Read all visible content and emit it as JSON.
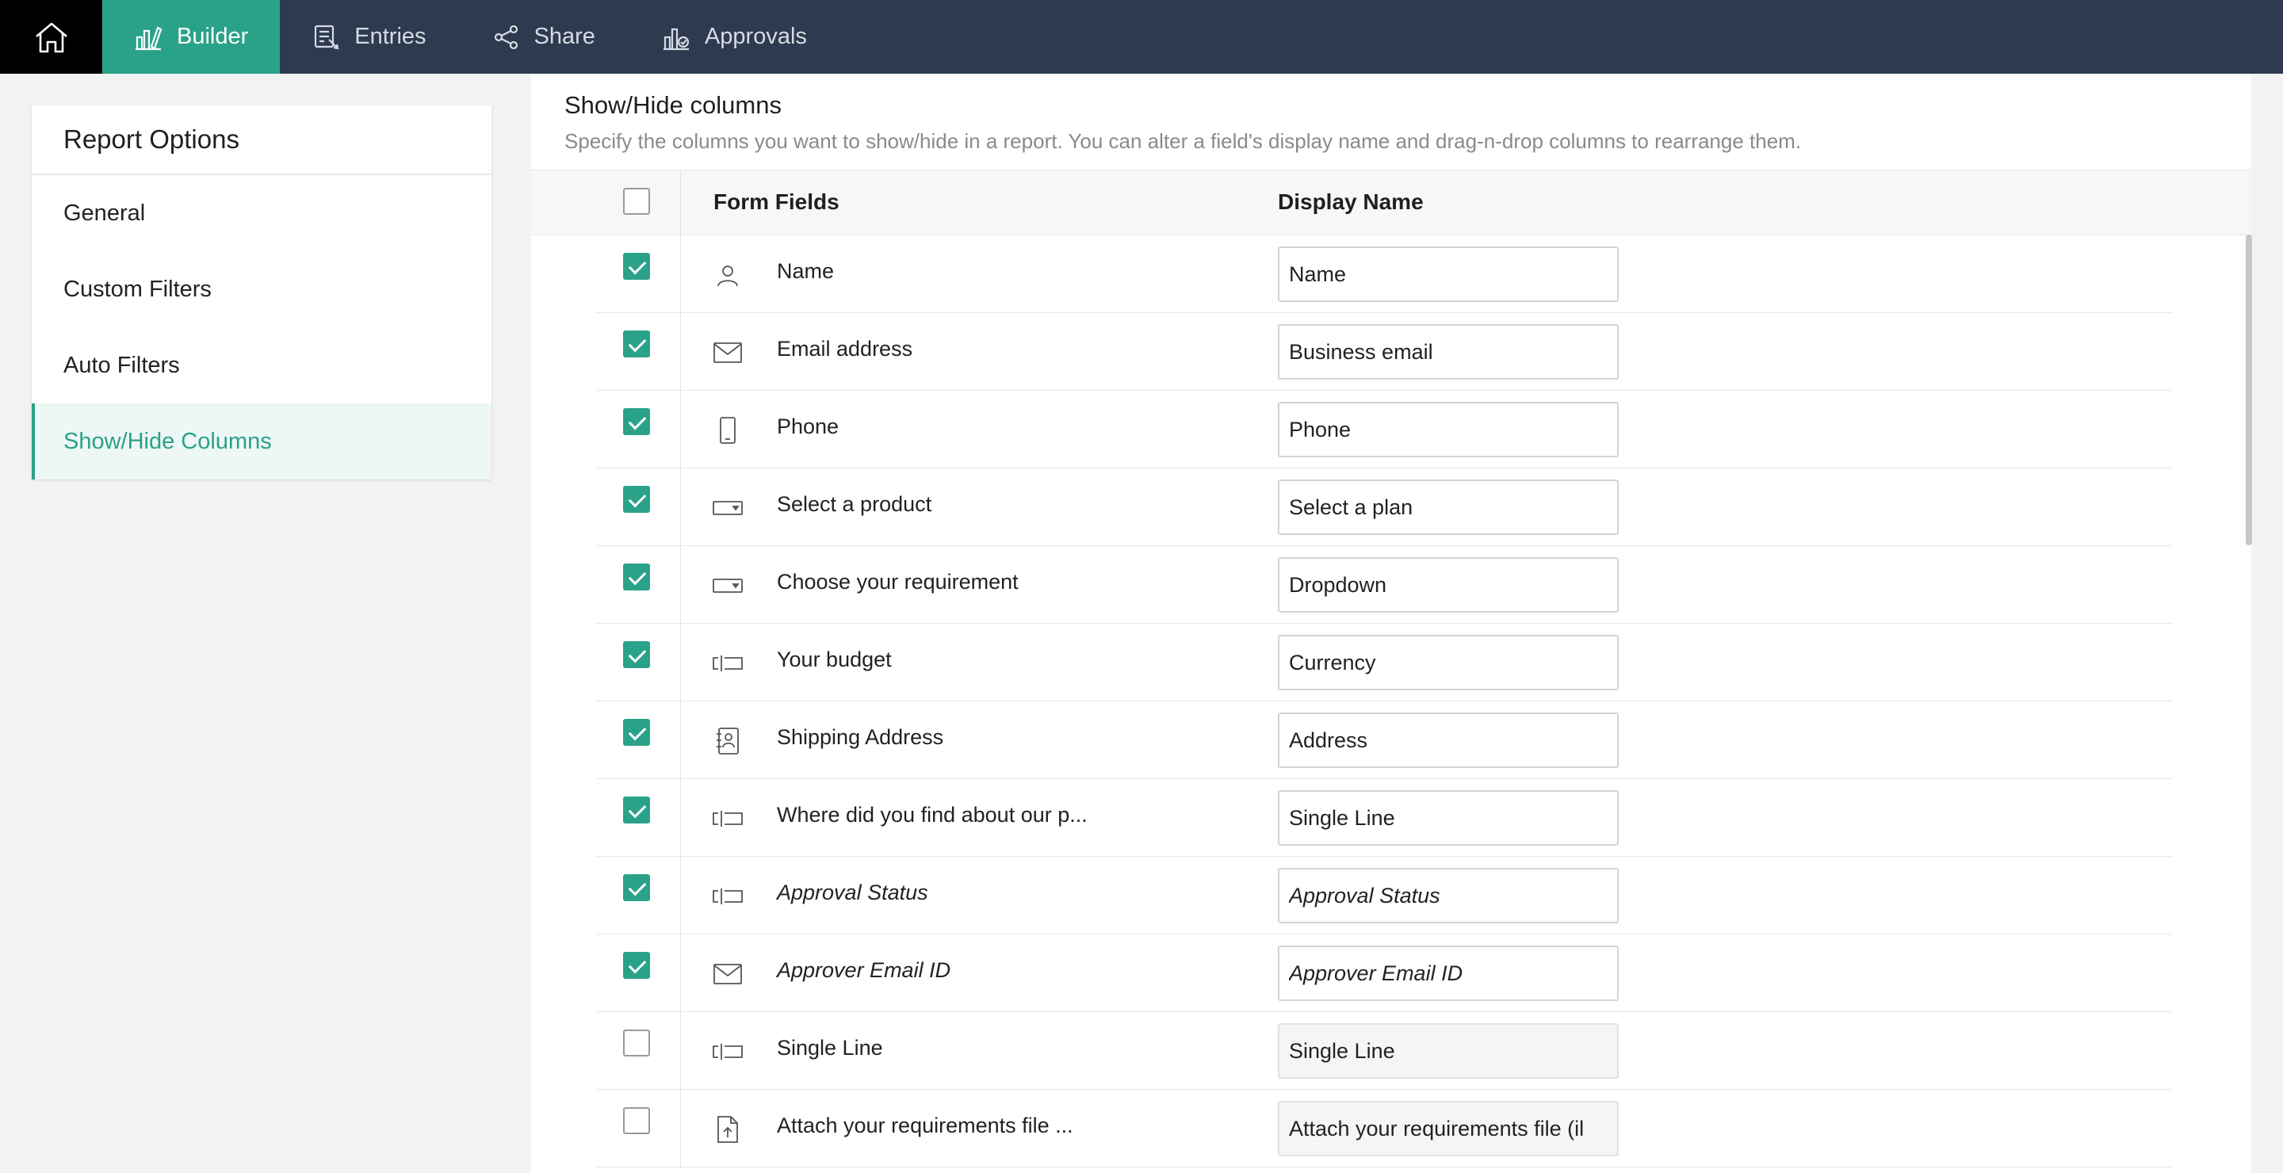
{
  "topnav": {
    "tabs": [
      {
        "label": "Builder",
        "icon": "builder-icon",
        "active": true
      },
      {
        "label": "Entries",
        "icon": "entries-icon",
        "active": false
      },
      {
        "label": "Share",
        "icon": "share-icon",
        "active": false
      },
      {
        "label": "Approvals",
        "icon": "approvals-icon",
        "active": false
      }
    ]
  },
  "sidebar": {
    "title": "Report Options",
    "items": [
      {
        "label": "General",
        "active": false
      },
      {
        "label": "Custom Filters",
        "active": false
      },
      {
        "label": "Auto Filters",
        "active": false
      },
      {
        "label": "Show/Hide Columns",
        "active": true
      }
    ]
  },
  "main": {
    "title": "Show/Hide columns",
    "description": "Specify the columns you want to show/hide in a report. You can alter a field's display name and drag-n-drop columns to rearrange them.",
    "header": {
      "fields": "Form Fields",
      "display": "Display Name"
    },
    "rows": [
      {
        "icon": "user-icon",
        "label": "Name",
        "display": "Name",
        "checked": true,
        "italic": false
      },
      {
        "icon": "email-icon",
        "label": "Email address",
        "display": "Business email",
        "checked": true,
        "italic": false
      },
      {
        "icon": "phone-icon",
        "label": "Phone",
        "display": "Phone",
        "checked": true,
        "italic": false
      },
      {
        "icon": "dropdown-icon",
        "label": "Select a product",
        "display": "Select a plan",
        "checked": true,
        "italic": false
      },
      {
        "icon": "dropdown-icon",
        "label": "Choose your requirement",
        "display": "Dropdown",
        "checked": true,
        "italic": false
      },
      {
        "icon": "single-line-icon",
        "label": "Your budget",
        "display": "Currency",
        "checked": true,
        "italic": false
      },
      {
        "icon": "address-icon",
        "label": "Shipping Address",
        "display": "Address",
        "checked": true,
        "italic": false
      },
      {
        "icon": "single-line-icon",
        "label": "Where did you find about our p...",
        "display": "Single Line",
        "checked": true,
        "italic": false
      },
      {
        "icon": "single-line-icon",
        "label": "Approval Status",
        "display": "Approval Status",
        "checked": true,
        "italic": true
      },
      {
        "icon": "email-icon",
        "label": "Approver Email ID",
        "display": "Approver Email ID",
        "checked": true,
        "italic": true
      },
      {
        "icon": "single-line-icon",
        "label": "Single Line",
        "display": "Single Line",
        "checked": false,
        "italic": false
      },
      {
        "icon": "file-upload-icon",
        "label": "Attach your requirements file ...",
        "display": "Attach your requirements file (il",
        "checked": false,
        "italic": false
      }
    ]
  },
  "colors": {
    "accent": "#2aa289",
    "topbar": "#2d3a4f",
    "home": "#000000"
  }
}
